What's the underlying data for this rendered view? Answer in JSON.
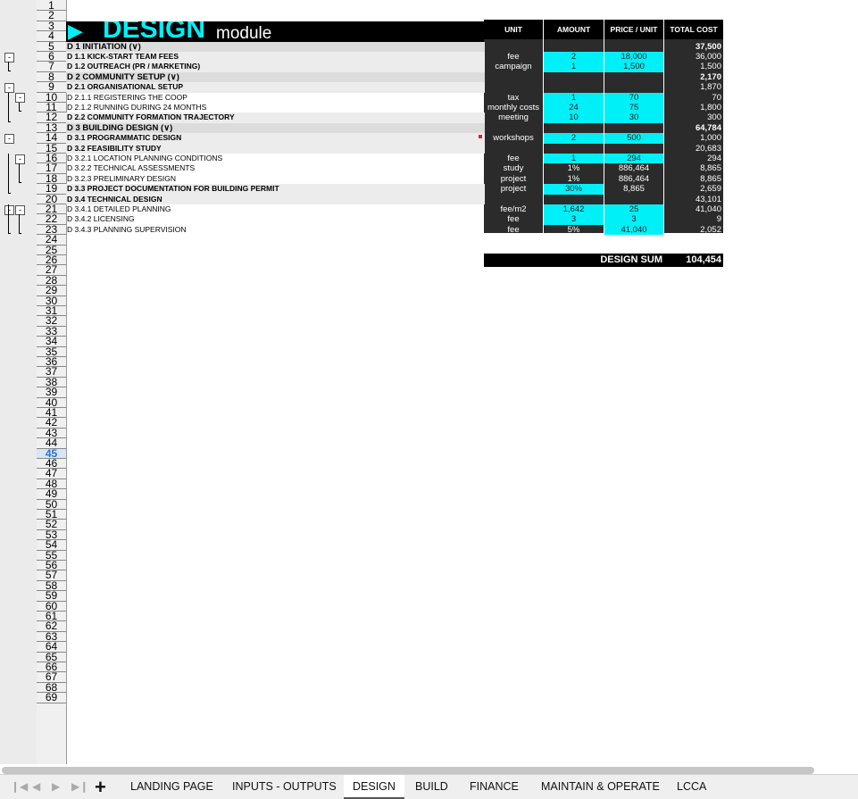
{
  "sheet": {
    "title_word": "DESIGN",
    "title_sub": "module",
    "headers": {
      "unit": "UNIT",
      "amount": "AMOUNT",
      "price": "PRICE / UNIT",
      "total": "TOTAL COST"
    },
    "rows": [
      {
        "label": "D 1 INITIATION (∨)",
        "total": "37,500"
      },
      {
        "label": "D 1.1 KICK-START TEAM FEES",
        "unit": "fee",
        "amount": "2",
        "price": "18,000",
        "total": "36,000"
      },
      {
        "label": "D 1.2 OUTREACH (PR / MARKETING)",
        "unit": "campaign",
        "amount": "1",
        "price": "1,500",
        "total": "1,500"
      },
      {
        "label": "D 2 COMMUNITY SETUP (∨)",
        "total": "2,170"
      },
      {
        "label": "D 2.1 ORGANISATIONAL SETUP",
        "total": "1,870"
      },
      {
        "label": "D 2.1.1 REGISTERING THE COOP",
        "unit": "tax",
        "amount": "1",
        "price": "70",
        "total": "70"
      },
      {
        "label": "D 2.1.2 RUNNING DURING 24 MONTHS",
        "unit": "monthly costs",
        "amount": "24",
        "price": "75",
        "total": "1,800"
      },
      {
        "label": "D 2.2 COMMUNITY FORMATION TRAJECTORY",
        "unit": "meeting",
        "amount": "10",
        "price": "30",
        "total": "300"
      },
      {
        "label": "D 3 BUILDING DESIGN (∨)",
        "total": "64,784"
      },
      {
        "label": "D 3.1 PROGRAMMATIC DESIGN",
        "unit": "workshops",
        "amount": "2",
        "price": "500",
        "total": "1,000"
      },
      {
        "label": "D 3.2 FEASIBILITY STUDY",
        "total": "20,683"
      },
      {
        "label": "D 3.2.1 LOCATION PLANNING CONDITIONS",
        "unit": "fee",
        "amount": "1",
        "price": "294",
        "total": "294"
      },
      {
        "label": "D 3.2.2 TECHNICAL ASSESSMENTS",
        "unit": "study",
        "amount": "1%",
        "price": "886,464",
        "total": "8,865"
      },
      {
        "label": "D 3.2.3 PRELIMINARY DESIGN",
        "unit": "project",
        "amount": "1%",
        "price": "886,464",
        "total": "8,865"
      },
      {
        "label": "D 3.3 PROJECT DOCUMENTATION FOR BUILDING PERMIT",
        "unit": "project",
        "amount": "30%",
        "price": "8,865",
        "total": "2,659"
      },
      {
        "label": "D 3.4 TECHNICAL DESIGN",
        "total": "43,101"
      },
      {
        "label": "D 3.4.1 DETAILED PLANNING",
        "unit": "fee/m2",
        "amount": "1,642",
        "price": "25",
        "total": "41,040"
      },
      {
        "label": "D 3.4.2 LICENSING",
        "unit": "fee",
        "amount": "3",
        "price": "3",
        "total": "9"
      },
      {
        "label": "D 3.4.3 PLANNING SUPERVISION",
        "unit": "fee",
        "amount": "5%",
        "price": "41,040",
        "total": "2,052"
      }
    ],
    "sum_label": "DESIGN SUM",
    "sum_value": "104,454"
  },
  "row_numbers": [
    "1",
    "2",
    "3",
    "4",
    "5",
    "6",
    "7",
    "8",
    "9",
    "10",
    "11",
    "12",
    "13",
    "14",
    "15",
    "16",
    "17",
    "18",
    "19",
    "20",
    "21",
    "22",
    "23",
    "24",
    "25",
    "26",
    "27",
    "28",
    "29",
    "30",
    "31",
    "32",
    "33",
    "34",
    "35",
    "36",
    "37",
    "38",
    "39",
    "40",
    "41",
    "42",
    "43",
    "44",
    "45",
    "46",
    "47",
    "48",
    "49",
    "50",
    "51",
    "52",
    "53",
    "54",
    "55",
    "56",
    "57",
    "58",
    "59",
    "60",
    "61",
    "62",
    "63",
    "64",
    "65",
    "66",
    "67",
    "68",
    "69"
  ],
  "selected_row": "45",
  "outline_buttons": [
    "-",
    "-",
    "-",
    "-",
    "-",
    "-",
    "-"
  ],
  "tabs": {
    "add_label": "+",
    "items": [
      "LANDING PAGE",
      "INPUTS - OUTPUTS",
      "DESIGN",
      "BUILD",
      "FINANCE",
      "MAINTAIN & OPERATE",
      "LCCA"
    ],
    "active": "DESIGN"
  },
  "nav_icons": [
    "first-sheet-icon",
    "prev-sheet-icon",
    "next-sheet-icon",
    "last-sheet-icon"
  ],
  "colors": {
    "accent_cyan": "#00f0f8",
    "table_dark": "#2b2b2b",
    "header_black": "#000000"
  }
}
